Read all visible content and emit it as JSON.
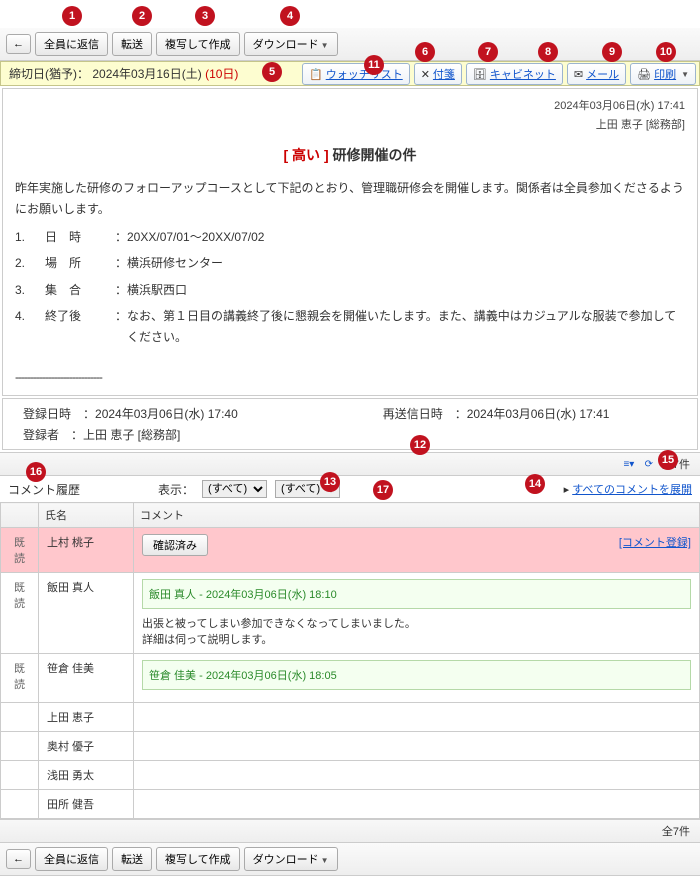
{
  "toolbar": {
    "reply_all": "全員に返信",
    "forward": "転送",
    "copy_create": "複写して作成",
    "download": "ダウンロード"
  },
  "deadline": {
    "label": "締切日(猶予)：",
    "date": "2024年03月16日(土)",
    "remaining": "(10日)"
  },
  "links": {
    "watchlist": "ウォッチリスト",
    "fusen": "付箋",
    "cabinet": "キャビネット",
    "mail": "メール",
    "print": "印刷"
  },
  "msg": {
    "datetime": "2024年03月06日(水) 17:41",
    "sender": "上田 恵子 [総務部]",
    "priority": "[ 高い ]",
    "title": "研修開催の件",
    "intro": "昨年実施した研修のフォローアップコースとして下記のとおり、管理職研修会を開催します。関係者は全員参加くださるようにお願いします。",
    "items": [
      {
        "n": "1.",
        "k": "日　時",
        "v": "20XX/07/01～20XX/07/02"
      },
      {
        "n": "2.",
        "k": "場　所",
        "v": "横浜研修センター"
      },
      {
        "n": "3.",
        "k": "集　合",
        "v": "横浜駅西口"
      },
      {
        "n": "4.",
        "k": "終了後",
        "v": "なお、第１日目の講義終了後に懇親会を開催いたします。また、講義中はカジュアルな服装で参加してください。"
      }
    ],
    "dashes": "-----------------------------"
  },
  "reg": {
    "labelDate": "登録日時　：",
    "date": "2024年03月06日(水) 17:40",
    "labelResend": "再送信日時　：",
    "resend": "2024年03月06日(水) 17:41",
    "labelBy": "登録者　：",
    "by": "上田 恵子 [総務部]"
  },
  "count": {
    "text": "全7件"
  },
  "cmthdr": {
    "title": "コメント履歴",
    "showLbl": "表示：",
    "opt1": "(すべて)",
    "opt2": "(すべて)",
    "expand": "すべてのコメントを展開"
  },
  "cols": {
    "name": "氏名",
    "cmt": "コメント"
  },
  "rows": [
    {
      "status": "既読",
      "name": "上村 桃子",
      "confirm": "確認済み",
      "reglink": "[コメント登録]",
      "hi": true
    },
    {
      "status": "既読",
      "name": "飯田 真人",
      "inner": {
        "who": "飯田 真人",
        "ts": " - 2024年03月06日(水) 18:10",
        "t1": "出張と被ってしまい参加できなくなってしまいました。",
        "t2": "詳細は伺って説明します。"
      }
    },
    {
      "status": "既読",
      "name": "笹倉 佳美",
      "inner": {
        "who": "笹倉 佳美",
        "ts": " - 2024年03月06日(水) 18:05"
      }
    },
    {
      "status": "",
      "name": "上田 恵子"
    },
    {
      "status": "",
      "name": "奥村 優子"
    },
    {
      "status": "",
      "name": "浅田 勇太"
    },
    {
      "status": "",
      "name": "田所 健吾"
    }
  ],
  "badges": [
    "1",
    "2",
    "3",
    "4",
    "5",
    "6",
    "7",
    "8",
    "9",
    "10",
    "11",
    "12",
    "13",
    "14",
    "15",
    "16",
    "17"
  ]
}
